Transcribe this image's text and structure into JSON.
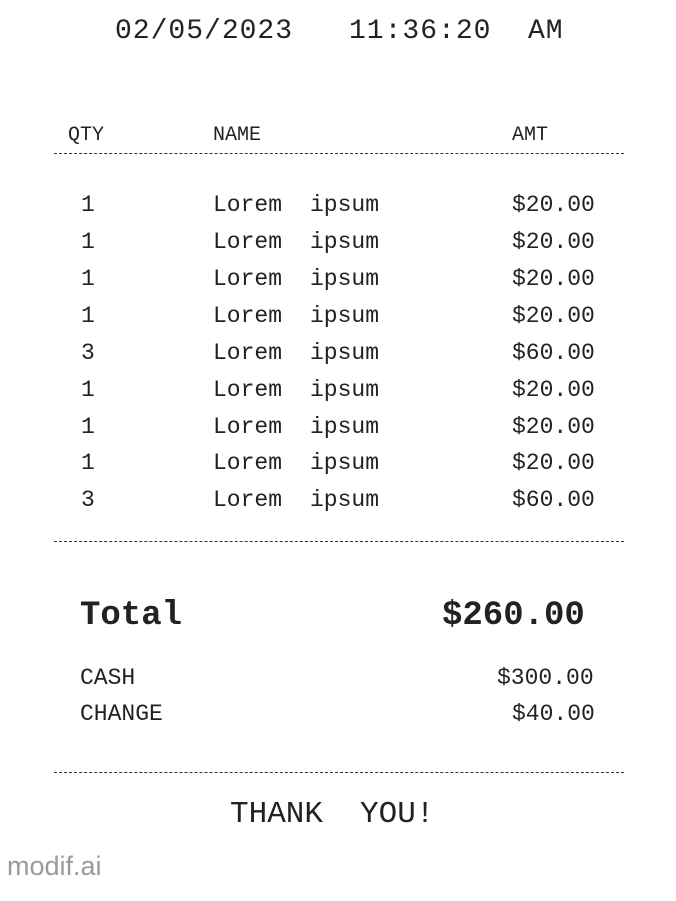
{
  "header": {
    "date": "02/05/2023",
    "time": "11:36:20",
    "ampm": "AM"
  },
  "columns": {
    "qty": "QTY",
    "name": "NAME",
    "amt": "AMT"
  },
  "items": [
    {
      "qty": "1",
      "name1": "Lorem",
      "name2": "ipsum",
      "amt": "$20.00"
    },
    {
      "qty": "1",
      "name1": "Lorem",
      "name2": "ipsum",
      "amt": "$20.00"
    },
    {
      "qty": "1",
      "name1": "Lorem",
      "name2": "ipsum",
      "amt": "$20.00"
    },
    {
      "qty": "1",
      "name1": "Lorem",
      "name2": "ipsum",
      "amt": "$20.00"
    },
    {
      "qty": "3",
      "name1": "Lorem",
      "name2": "ipsum",
      "amt": "$60.00"
    },
    {
      "qty": "1",
      "name1": "Lorem",
      "name2": "ipsum",
      "amt": "$20.00"
    },
    {
      "qty": "1",
      "name1": "Lorem",
      "name2": "ipsum",
      "amt": "$20.00"
    },
    {
      "qty": "1",
      "name1": "Lorem",
      "name2": "ipsum",
      "amt": "$20.00"
    },
    {
      "qty": "3",
      "name1": "Lorem",
      "name2": "ipsum",
      "amt": "$60.00"
    }
  ],
  "totals": {
    "total_label": "Total",
    "total_value": "$260.00",
    "cash_label": "CASH",
    "cash_value": "$300.00",
    "change_label": "CHANGE",
    "change_value": "$40.00"
  },
  "footer": {
    "thank": "THANK",
    "you": "YOU!"
  },
  "branding": {
    "watermark": "modif.ai"
  }
}
